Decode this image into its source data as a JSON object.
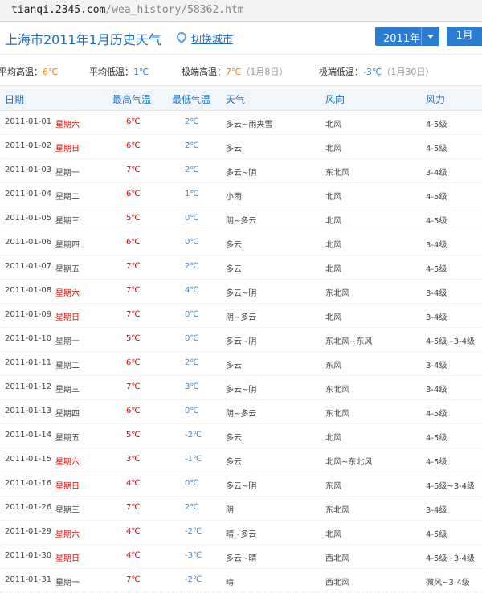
{
  "browser": {
    "url_domain": "tianqi.2345.com",
    "url_path": "/wea_history/58362.htm"
  },
  "header": {
    "title": "上海市2011年1月历史天气",
    "switch_city": "切换城市",
    "year_selector": "2011年",
    "month_selector": "1月"
  },
  "stats": {
    "avg_high_label": "平均高温：",
    "avg_high_value": "6℃",
    "avg_low_label": "平均低温：",
    "avg_low_value": "1℃",
    "max_high_label": "极端高温：",
    "max_high_value": "7℃",
    "max_high_note": "（1月8日）",
    "min_low_label": "极端低温：",
    "min_low_value": "-3℃",
    "min_low_note": "（1月30日）"
  },
  "table": {
    "headers": [
      "日期",
      "最高气温",
      "最低气温",
      "天气",
      "风向",
      "风力"
    ],
    "rows": [
      [
        "2011-01-01",
        "星期六",
        "6℃",
        "2℃",
        "多云~雨夹雪",
        "北风",
        "4-5级"
      ],
      [
        "2011-01-02",
        "星期日",
        "6℃",
        "2℃",
        "多云",
        "北风",
        "4-5级"
      ],
      [
        "2011-01-03",
        "星期一",
        "7℃",
        "2℃",
        "多云~阴",
        "东北风",
        "3-4级"
      ],
      [
        "2011-01-04",
        "星期二",
        "6℃",
        "1℃",
        "小雨",
        "北风",
        "4-5级"
      ],
      [
        "2011-01-05",
        "星期三",
        "5℃",
        "0℃",
        "阴~多云",
        "北风",
        "4-5级"
      ],
      [
        "2011-01-06",
        "星期四",
        "6℃",
        "0℃",
        "多云",
        "北风",
        "3-4级"
      ],
      [
        "2011-01-07",
        "星期五",
        "7℃",
        "2℃",
        "多云",
        "北风",
        "4-5级"
      ],
      [
        "2011-01-08",
        "星期六",
        "7℃",
        "4℃",
        "多云~阴",
        "东北风",
        "3-4级"
      ],
      [
        "2011-01-09",
        "星期日",
        "7℃",
        "0℃",
        "阴~多云",
        "北风",
        "3-4级"
      ],
      [
        "2011-01-10",
        "星期一",
        "5℃",
        "0℃",
        "多云~阴",
        "东北风~东风",
        "4-5级~3-4级"
      ],
      [
        "2011-01-11",
        "星期二",
        "6℃",
        "2℃",
        "多云",
        "东风",
        "3-4级"
      ],
      [
        "2011-01-12",
        "星期三",
        "7℃",
        "3℃",
        "多云~阴",
        "东北风",
        "3-4级"
      ],
      [
        "2011-01-13",
        "星期四",
        "6℃",
        "0℃",
        "阴~多云",
        "东北风",
        "4-5级"
      ],
      [
        "2011-01-14",
        "星期五",
        "5℃",
        "-2℃",
        "多云",
        "北风",
        "4-5级"
      ],
      [
        "2011-01-15",
        "星期六",
        "3℃",
        "-1℃",
        "多云",
        "北风~东北风",
        "4-5级"
      ],
      [
        "2011-01-16",
        "星期日",
        "4℃",
        "0℃",
        "多云~阴",
        "东风",
        "4-5级~3-4级"
      ],
      [
        "2011-01-26",
        "星期三",
        "7℃",
        "2℃",
        "阴",
        "东北风",
        "3-4级"
      ],
      [
        "2011-01-29",
        "星期六",
        "4℃",
        "-2℃",
        "晴~多云",
        "北风",
        "4-5级"
      ],
      [
        "2011-01-30",
        "星期日",
        "4℃",
        "-3℃",
        "多云~晴",
        "西北风",
        "4-5级~3-4级"
      ],
      [
        "2011-01-31",
        "星期一",
        "7℃",
        "-2℃",
        "晴",
        "西北风",
        "微风~3-4级"
      ]
    ]
  }
}
